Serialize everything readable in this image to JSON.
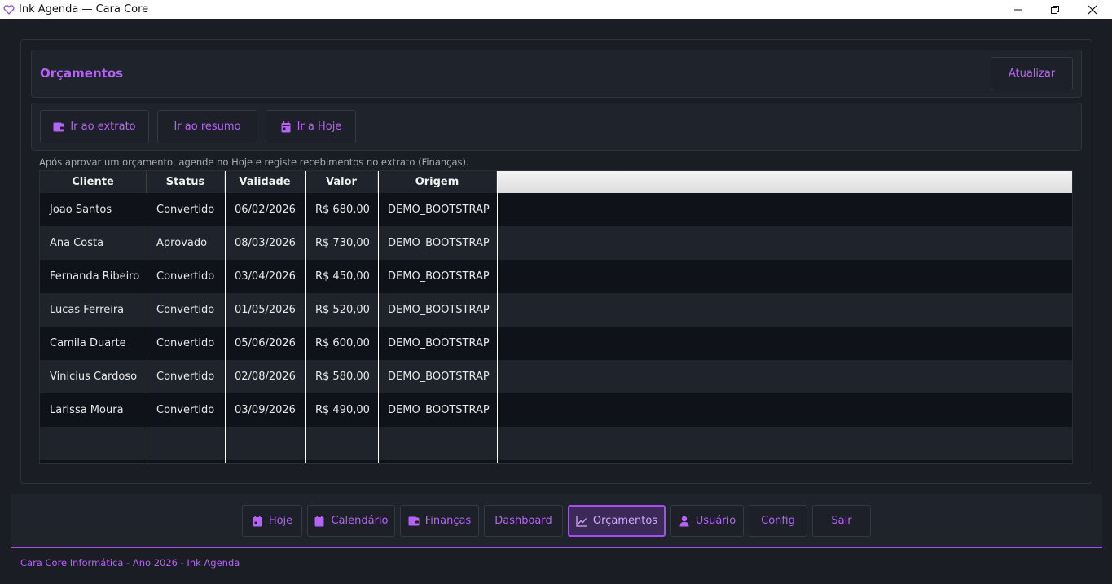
{
  "window": {
    "title": "Ink Agenda — Cara Core",
    "icons": {
      "app": "heart-icon",
      "minimize": "minimize-icon",
      "maximize": "restore-icon",
      "close": "close-icon"
    }
  },
  "header": {
    "title": "Orçamentos",
    "refresh_label": "Atualizar"
  },
  "actions": [
    {
      "label": "Ir ao extrato",
      "icon": "wallet-icon"
    },
    {
      "label": "Ir ao resumo",
      "icon": ""
    },
    {
      "label": "Ir a Hoje",
      "icon": "calendar-icon"
    }
  ],
  "hint": "Após aprovar um orçamento, agende no Hoje e registe recebimentos no extrato (Finanças).",
  "table": {
    "columns": [
      "Cliente",
      "Status",
      "Validade",
      "Valor",
      "Origem"
    ],
    "rows": [
      [
        "Joao Santos",
        "Convertido",
        "06/02/2026",
        "R$ 680,00",
        "DEMO_BOOTSTRAP"
      ],
      [
        "Ana Costa",
        "Aprovado",
        "08/03/2026",
        "R$ 730,00",
        "DEMO_BOOTSTRAP"
      ],
      [
        "Fernanda Ribeiro",
        "Convertido",
        "03/04/2026",
        "R$ 450,00",
        "DEMO_BOOTSTRAP"
      ],
      [
        "Lucas Ferreira",
        "Convertido",
        "01/05/2026",
        "R$ 520,00",
        "DEMO_BOOTSTRAP"
      ],
      [
        "Camila Duarte",
        "Convertido",
        "05/06/2026",
        "R$ 600,00",
        "DEMO_BOOTSTRAP"
      ],
      [
        "Vinicius Cardoso",
        "Convertido",
        "02/08/2026",
        "R$ 580,00",
        "DEMO_BOOTSTRAP"
      ],
      [
        "Larissa Moura",
        "Convertido",
        "03/09/2026",
        "R$ 490,00",
        "DEMO_BOOTSTRAP"
      ]
    ]
  },
  "nav": [
    {
      "label": "Hoje",
      "icon": "calendar-icon",
      "active": false
    },
    {
      "label": "Calendário",
      "icon": "calendar-icon",
      "active": false
    },
    {
      "label": "Finanças",
      "icon": "wallet-icon",
      "active": false
    },
    {
      "label": "Dashboard",
      "icon": "",
      "active": false
    },
    {
      "label": "Orçamentos",
      "icon": "chart-line-icon",
      "active": true
    },
    {
      "label": "Usuário",
      "icon": "user-icon",
      "active": false
    },
    {
      "label": "Config",
      "icon": "",
      "active": false
    },
    {
      "label": "Sair",
      "icon": "",
      "active": false
    }
  ],
  "footer": "Cara Core Informática - Ano 2026 - Ink Agenda",
  "colors": {
    "accent": "#b563f5",
    "accent_border": "#a64cf0",
    "background": "#1a1d24",
    "panel": "#1f232b"
  }
}
